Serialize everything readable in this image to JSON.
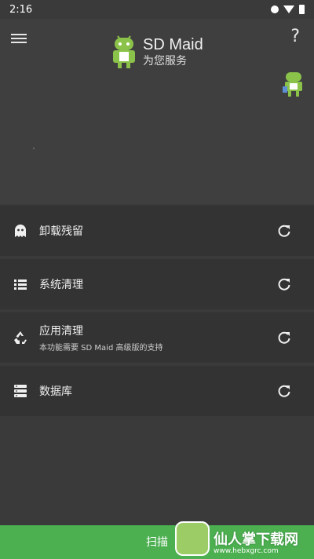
{
  "status_bar": {
    "time": "2:16"
  },
  "header": {
    "app_title": "SD Maid",
    "app_subtitle": "为您服务",
    "help_label": "?"
  },
  "tools": [
    {
      "label": "卸载残留",
      "subtitle": "",
      "icon": "ghost-icon"
    },
    {
      "label": "系统清理",
      "subtitle": "",
      "icon": "list-icon"
    },
    {
      "label": "应用清理",
      "subtitle": "本功能需要 SD Maid 高级版的支持",
      "icon": "recycle-icon"
    },
    {
      "label": "数据库",
      "subtitle": "",
      "icon": "database-icon"
    }
  ],
  "bottom_bar": {
    "scan_label": "扫描"
  },
  "watermark": {
    "text": "仙人掌下载网",
    "url": "www.hebxgrc.com"
  },
  "colors": {
    "background": "#3a3a3a",
    "row": "#333333",
    "accent": "#4caf50"
  }
}
